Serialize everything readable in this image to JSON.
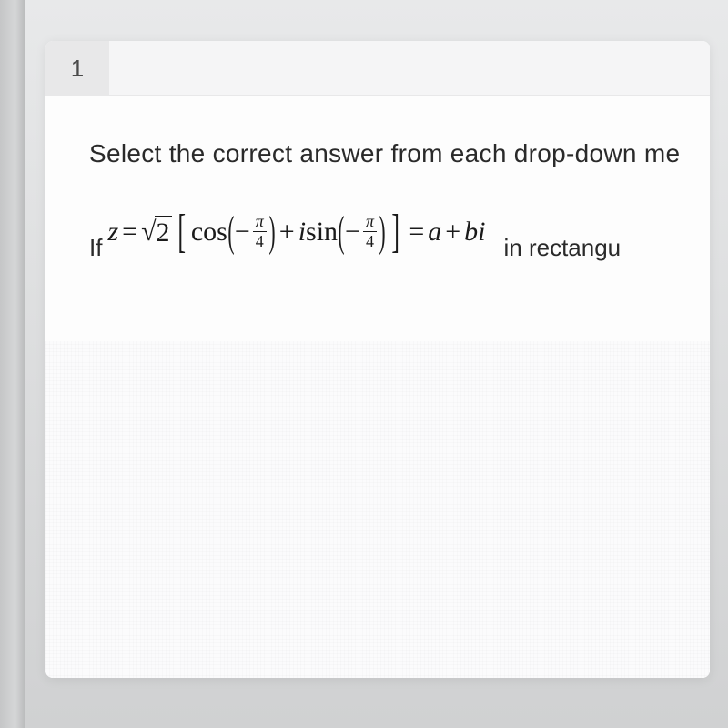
{
  "tab": {
    "label": "1"
  },
  "instruction": "Select the correct answer from each drop-down me",
  "eq_if": "If",
  "eq_trail": "in rectangu",
  "eq": {
    "z": "z",
    "equals": "=",
    "sqrt_sym": "√",
    "sqrt_arg": "2",
    "cos": "cos",
    "plus": "+",
    "i": "i",
    "sin": "sin",
    "neg": "−",
    "pi": "π",
    "four": "4",
    "a": "a",
    "b": "b"
  }
}
